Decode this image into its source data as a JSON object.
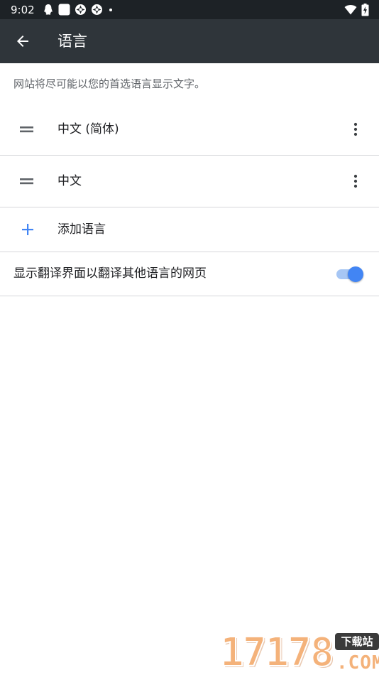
{
  "status_bar": {
    "time": "9:02",
    "left_icons": [
      "qq-icon",
      "square-app-icon",
      "aperture-icon",
      "aperture-icon",
      "dot-icon"
    ],
    "right_icons": [
      "wifi-icon",
      "battery-charging-icon"
    ]
  },
  "app_bar": {
    "title": "语言",
    "back_icon": "arrow-back-icon",
    "background": "#2f353a"
  },
  "main": {
    "description": "网站将尽可能以您的首选语言显示文字。",
    "languages": [
      {
        "label": "中文 (简体)",
        "handle_icon": "drag-handle-icon",
        "menu_icon": "more-vert-icon"
      },
      {
        "label": "中文",
        "handle_icon": "drag-handle-icon",
        "menu_icon": "more-vert-icon"
      }
    ],
    "add_language": {
      "label": "添加语言",
      "icon": "plus-icon",
      "icon_color": "#4285f4"
    },
    "translate_toggle": {
      "label": "显示翻译界面以翻译其他语言的网页",
      "checked": true,
      "accent": "#4285f4"
    }
  },
  "watermark": {
    "digits": "17178",
    "badge": "下载站",
    "suffix": ".COM"
  }
}
